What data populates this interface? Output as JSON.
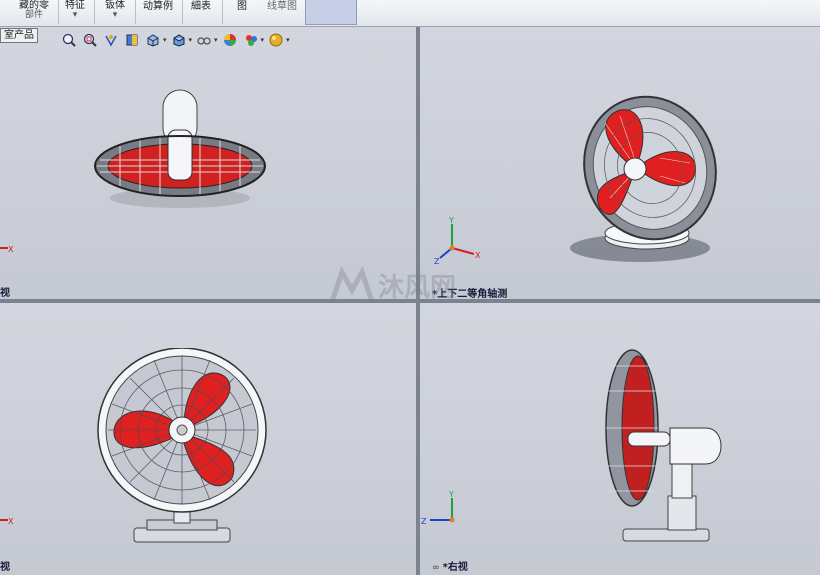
{
  "toolbar": {
    "items": [
      {
        "label": "藏的零",
        "sub": "部件"
      },
      {
        "label": "特征",
        "sub": "▾"
      },
      {
        "label": "钣体",
        "sub": "▾"
      },
      {
        "label": "动算例",
        "sub": ""
      },
      {
        "label": "細表",
        "sub": ""
      },
      {
        "label": "图",
        "sub": ""
      },
      {
        "label": "线草图",
        "sub": ""
      }
    ]
  },
  "part_tab": "室产品",
  "hud_icons": [
    "zoom-to-fit-icon",
    "zoom-area-icon",
    "previous-view-icon",
    "section-view-icon",
    "view-orientation-icon",
    "display-style-icon",
    "hide-show-icon",
    "edit-appearance-icon",
    "apply-scene-icon",
    "view-settings-icon"
  ],
  "viewports": {
    "top_left": {
      "label": "视"
    },
    "top_right": {
      "label": "*上下二等角轴测"
    },
    "bottom_left": {
      "label": "视"
    },
    "bottom_right": {
      "label": "*右视"
    }
  },
  "triad": {
    "x": "X",
    "y": "Y",
    "z": "Z"
  },
  "watermark": {
    "text": "沐风网"
  },
  "colors": {
    "blade_red": "#e02020",
    "cage_gray": "#8a8f99",
    "axis_x": "#d42020",
    "axis_y": "#20a040",
    "axis_z": "#2040d0"
  }
}
